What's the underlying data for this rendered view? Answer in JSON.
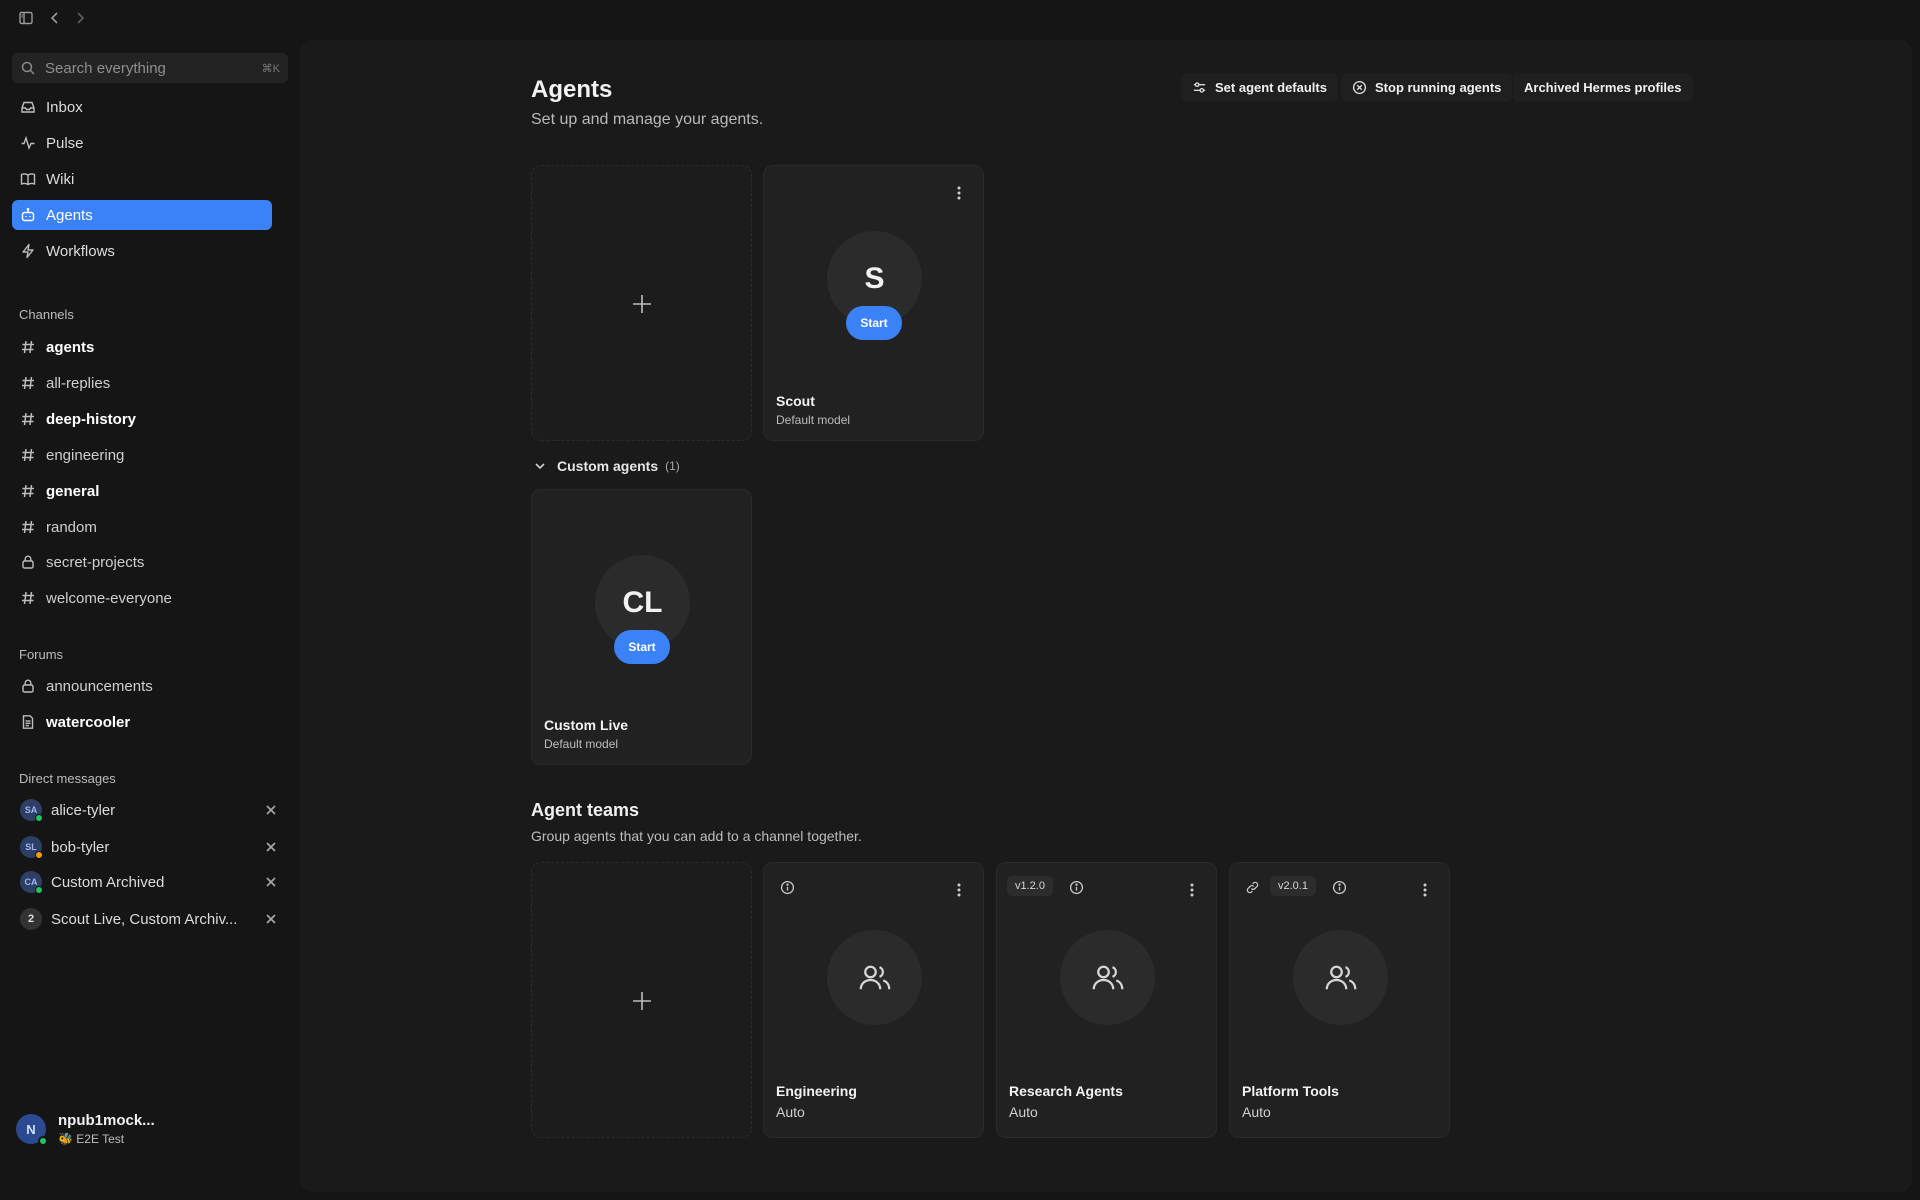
{
  "sidebar": {
    "search_placeholder": "Search everything",
    "search_shortcut": "⌘K",
    "nav": [
      {
        "label": "Inbox",
        "icon": "inbox-icon"
      },
      {
        "label": "Pulse",
        "icon": "pulse-icon"
      },
      {
        "label": "Wiki",
        "icon": "book-icon"
      },
      {
        "label": "Agents",
        "icon": "bot-icon",
        "active": true
      },
      {
        "label": "Workflows",
        "icon": "zap-icon"
      }
    ],
    "channels_heading": "Channels",
    "channels": [
      {
        "label": "agents",
        "bold": true,
        "icon": "hash-icon"
      },
      {
        "label": "all-replies",
        "bold": false,
        "icon": "hash-icon"
      },
      {
        "label": "deep-history",
        "bold": true,
        "icon": "hash-icon"
      },
      {
        "label": "engineering",
        "bold": false,
        "icon": "hash-icon"
      },
      {
        "label": "general",
        "bold": true,
        "icon": "hash-icon"
      },
      {
        "label": "random",
        "bold": false,
        "icon": "hash-icon"
      },
      {
        "label": "secret-projects",
        "bold": false,
        "icon": "lock-icon"
      },
      {
        "label": "welcome-everyone",
        "bold": false,
        "icon": "hash-icon"
      }
    ],
    "forums_heading": "Forums",
    "forums": [
      {
        "label": "announcements",
        "bold": false,
        "icon": "lock-icon"
      },
      {
        "label": "watercooler",
        "bold": true,
        "icon": "document-icon"
      }
    ],
    "dms_heading": "Direct messages",
    "dms": [
      {
        "label": "alice-tyler",
        "initials": "SA",
        "status_color": "#22c55e"
      },
      {
        "label": "bob-tyler",
        "initials": "SL",
        "status_color": "#f59e0b"
      },
      {
        "label": "Custom Archived",
        "initials": "CA",
        "status_color": "#22c55e"
      },
      {
        "label": "Scout Live, Custom Archiv...",
        "initials": "2",
        "status_color": ""
      }
    ],
    "user": {
      "name": "npub1mock...",
      "initial": "N",
      "status": "🐝 E2E Test"
    }
  },
  "main": {
    "title": "Agents",
    "subtitle": "Set up and manage your agents.",
    "header_buttons": [
      {
        "label": "Set agent defaults",
        "icon": "sliders-icon"
      },
      {
        "label": "Stop running agents",
        "icon": "stop-circle-icon"
      },
      {
        "label": "Archived Hermes profiles",
        "icon": ""
      }
    ],
    "agents": [
      {
        "name": "Scout",
        "model": "Default model",
        "initials": "S",
        "start_label": "Start"
      }
    ],
    "custom_group": {
      "label": "Custom agents",
      "count": "(1)"
    },
    "custom_agents": [
      {
        "name": "Custom Live",
        "model": "Default model",
        "initials": "CL",
        "start_label": "Start"
      }
    ],
    "teams_title": "Agent teams",
    "teams_subtitle": "Group agents that you can add to a channel together.",
    "teams": [
      {
        "name": "Engineering",
        "mode": "Auto",
        "version": "",
        "linked": false
      },
      {
        "name": "Research Agents",
        "mode": "Auto",
        "version": "v1.2.0",
        "linked": false
      },
      {
        "name": "Platform Tools",
        "mode": "Auto",
        "version": "v2.0.1",
        "linked": true
      }
    ]
  },
  "colors": {
    "accent": "#3b82f6",
    "background": "#151515",
    "panel": "#1a1a1a",
    "card": "#212121"
  }
}
